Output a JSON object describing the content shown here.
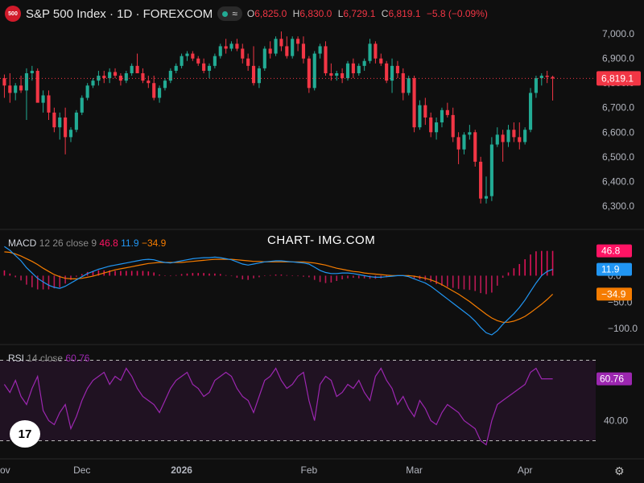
{
  "header": {
    "logo_text": "500",
    "title": "S&P 500 Index · 1D · FOREXCOM",
    "pill_symbol": "≈",
    "open_label": "O",
    "open": "6,825.0",
    "high_label": "H",
    "high": "6,830.0",
    "low_label": "L",
    "low": "6,729.1",
    "close_label": "C",
    "close": "6,819.1",
    "change": "−5.8 (−0.09%)"
  },
  "watermark": "CHART- IMG.COM",
  "tv_logo": "17",
  "colors": {
    "up": "#22ab94",
    "down": "#f23645",
    "macd": "#2196f3",
    "signal": "#f57c00",
    "rsi": "#9c27b0",
    "background": "#0f0f0f"
  },
  "chart_data": [
    {
      "type": "candlestick",
      "title": "S&P 500 Index · 1D · FOREXCOM",
      "y_ticks": [
        6300,
        6400,
        6500,
        6600,
        6700,
        6800,
        6900,
        7000
      ],
      "y_tick_labels": [
        "6,300.0",
        "6,400.0",
        "6,500.0",
        "6,600.0",
        "6,700.0",
        "6,800.0",
        "6,900.0",
        "7,000.0"
      ],
      "ylim": [
        6270,
        7030
      ],
      "x_labels": [
        "ov",
        "Dec",
        "2026",
        "Feb",
        "Mar",
        "Apr"
      ],
      "last_price_label": "6,819.1",
      "last_price": 6819.1,
      "candles": [
        [
          6820,
          6835,
          6740,
          6790
        ],
        [
          6790,
          6840,
          6720,
          6760
        ],
        [
          6760,
          6800,
          6730,
          6790
        ],
        [
          6790,
          6830,
          6760,
          6770
        ],
        [
          6770,
          6860,
          6650,
          6840
        ],
        [
          6840,
          6870,
          6810,
          6850
        ],
        [
          6850,
          6860,
          6750,
          6720
        ],
        [
          6720,
          6770,
          6680,
          6750
        ],
        [
          6750,
          6770,
          6650,
          6680
        ],
        [
          6680,
          6700,
          6600,
          6620
        ],
        [
          6620,
          6680,
          6570,
          6660
        ],
        [
          6660,
          6700,
          6510,
          6580
        ],
        [
          6580,
          6620,
          6560,
          6610
        ],
        [
          6610,
          6690,
          6600,
          6680
        ],
        [
          6680,
          6750,
          6670,
          6740
        ],
        [
          6740,
          6800,
          6730,
          6790
        ],
        [
          6790,
          6820,
          6780,
          6810
        ],
        [
          6810,
          6850,
          6790,
          6830
        ],
        [
          6830,
          6850,
          6800,
          6820
        ],
        [
          6820,
          6860,
          6800,
          6845
        ],
        [
          6845,
          6860,
          6820,
          6830
        ],
        [
          6830,
          6840,
          6790,
          6810
        ],
        [
          6810,
          6850,
          6800,
          6840
        ],
        [
          6840,
          6880,
          6830,
          6870
        ],
        [
          6870,
          6920,
          6850,
          6840
        ],
        [
          6840,
          6860,
          6800,
          6810
        ],
        [
          6810,
          6830,
          6780,
          6800
        ],
        [
          6800,
          6830,
          6730,
          6740
        ],
        [
          6740,
          6790,
          6720,
          6780
        ],
        [
          6780,
          6820,
          6770,
          6810
        ],
        [
          6810,
          6860,
          6800,
          6850
        ],
        [
          6850,
          6880,
          6840,
          6870
        ],
        [
          6870,
          6920,
          6860,
          6910
        ],
        [
          6910,
          6930,
          6890,
          6920
        ],
        [
          6920,
          6930,
          6890,
          6900
        ],
        [
          6900,
          6910,
          6870,
          6880
        ],
        [
          6880,
          6900,
          6840,
          6850
        ],
        [
          6850,
          6880,
          6820,
          6870
        ],
        [
          6870,
          6920,
          6860,
          6910
        ],
        [
          6910,
          6960,
          6900,
          6950
        ],
        [
          6950,
          6980,
          6920,
          6940
        ],
        [
          6940,
          6970,
          6930,
          6960
        ],
        [
          6960,
          6980,
          6930,
          6940
        ],
        [
          6940,
          6960,
          6880,
          6900
        ],
        [
          6900,
          6920,
          6850,
          6870
        ],
        [
          6870,
          6950,
          6790,
          6800
        ],
        [
          6800,
          6870,
          6780,
          6860
        ],
        [
          6860,
          6950,
          6850,
          6940
        ],
        [
          6940,
          6970,
          6900,
          6920
        ],
        [
          6920,
          6990,
          6910,
          6980
        ],
        [
          6980,
          7010,
          6930,
          6950
        ],
        [
          6950,
          6990,
          6900,
          6910
        ],
        [
          6910,
          6990,
          6900,
          6980
        ],
        [
          6980,
          6990,
          6930,
          6960
        ],
        [
          6960,
          6990,
          6880,
          6900
        ],
        [
          6900,
          6910,
          6760,
          6780
        ],
        [
          6780,
          6930,
          6770,
          6920
        ],
        [
          6920,
          6960,
          6900,
          6950
        ],
        [
          6950,
          6970,
          6830,
          6840
        ],
        [
          6840,
          6880,
          6810,
          6830
        ],
        [
          6830,
          6850,
          6810,
          6840
        ],
        [
          6840,
          6860,
          6800,
          6820
        ],
        [
          6820,
          6890,
          6810,
          6880
        ],
        [
          6880,
          6900,
          6820,
          6840
        ],
        [
          6840,
          6880,
          6830,
          6870
        ],
        [
          6870,
          6900,
          6850,
          6890
        ],
        [
          6890,
          6980,
          6880,
          6960
        ],
        [
          6960,
          6970,
          6880,
          6900
        ],
        [
          6900,
          6920,
          6870,
          6880
        ],
        [
          6880,
          6890,
          6800,
          6810
        ],
        [
          6810,
          6900,
          6760,
          6870
        ],
        [
          6870,
          6890,
          6820,
          6840
        ],
        [
          6840,
          6860,
          6730,
          6760
        ],
        [
          6760,
          6830,
          6750,
          6820
        ],
        [
          6820,
          6830,
          6600,
          6620
        ],
        [
          6620,
          6730,
          6610,
          6710
        ],
        [
          6710,
          6740,
          6630,
          6660
        ],
        [
          6660,
          6680,
          6580,
          6600
        ],
        [
          6600,
          6660,
          6570,
          6640
        ],
        [
          6640,
          6700,
          6620,
          6690
        ],
        [
          6690,
          6720,
          6660,
          6670
        ],
        [
          6670,
          6700,
          6560,
          6580
        ],
        [
          6580,
          6600,
          6470,
          6530
        ],
        [
          6530,
          6600,
          6510,
          6590
        ],
        [
          6590,
          6630,
          6570,
          6600
        ],
        [
          6600,
          6610,
          6460,
          6480
        ],
        [
          6480,
          6500,
          6310,
          6330
        ],
        [
          6330,
          6420,
          6310,
          6340
        ],
        [
          6340,
          6580,
          6320,
          6550
        ],
        [
          6550,
          6620,
          6540,
          6590
        ],
        [
          6590,
          6610,
          6480,
          6560
        ],
        [
          6560,
          6630,
          6540,
          6610
        ],
        [
          6610,
          6640,
          6560,
          6580
        ],
        [
          6580,
          6640,
          6530,
          6560
        ],
        [
          6560,
          6620,
          6550,
          6610
        ],
        [
          6610,
          6780,
          6600,
          6760
        ],
        [
          6760,
          6830,
          6740,
          6820
        ],
        [
          6820,
          6840,
          6790,
          6830
        ],
        [
          6830,
          6850,
          6800,
          6825
        ],
        [
          6825,
          6830,
          6729,
          6819
        ]
      ]
    },
    {
      "type": "line",
      "title": "MACD",
      "params": "12 26 close 9",
      "legend_values": [
        "46.8",
        "11.9",
        "−34.9"
      ],
      "y_tick_labels": [
        "0.0",
        "−50.0",
        "−100.0"
      ],
      "y_ticks": [
        0,
        -50,
        -100
      ],
      "ylim": [
        -115,
        60
      ],
      "badges": [
        {
          "text": "46.8",
          "value": 46.8,
          "color": "#ff1464"
        },
        {
          "text": "11.9",
          "value": 11.9,
          "color": "#2196f3"
        },
        {
          "text": "−34.9",
          "value": -34.9,
          "color": "#f57c00"
        }
      ],
      "series": [
        {
          "values": [
            55,
            48,
            38,
            28,
            15,
            5,
            -5,
            -12,
            -18,
            -22,
            -24,
            -20,
            -14,
            -8,
            -2,
            4,
            8,
            12,
            15,
            18,
            20,
            22,
            24,
            26,
            28,
            30,
            31,
            30,
            27,
            25,
            24,
            26,
            28,
            30,
            32,
            33,
            34,
            34,
            35,
            34,
            32,
            30,
            26,
            22,
            20,
            22,
            24,
            26,
            27,
            28,
            28,
            27,
            26,
            25,
            24,
            22,
            16,
            10,
            6,
            4,
            4,
            5,
            5,
            4,
            2,
            0,
            -2,
            -3,
            -3,
            -2,
            -1,
            0,
            0,
            -2,
            -6,
            -10,
            -14,
            -20,
            -28,
            -36,
            -44,
            -52,
            -60,
            -68,
            -76,
            -86,
            -98,
            -108,
            -112,
            -104,
            -92,
            -82,
            -72,
            -60,
            -46,
            -30,
            -14,
            0,
            8,
            11.9
          ]
        },
        {
          "values": [
            45,
            44,
            41,
            37,
            32,
            27,
            21,
            14,
            8,
            2,
            -2,
            -5,
            -6,
            -6,
            -5,
            -3,
            -1,
            2,
            5,
            8,
            11,
            13,
            15,
            17,
            19,
            21,
            23,
            24,
            25,
            25,
            25,
            25,
            25,
            26,
            27,
            28,
            29,
            30,
            31,
            31,
            31,
            31,
            30,
            29,
            28,
            27,
            27,
            26,
            26,
            26,
            26,
            26,
            26,
            26,
            26,
            25,
            24,
            22,
            20,
            17,
            14,
            12,
            10,
            8,
            7,
            5,
            4,
            3,
            2,
            1,
            0,
            0,
            0,
            0,
            -1,
            -3,
            -5,
            -8,
            -12,
            -17,
            -23,
            -29,
            -35,
            -42,
            -49,
            -57,
            -65,
            -73,
            -80,
            -85,
            -88,
            -88,
            -86,
            -82,
            -77,
            -70,
            -62,
            -54,
            -45,
            -34.9
          ]
        },
        {
          "histogram": [
            10,
            4,
            -3,
            -9,
            -17,
            -22,
            -26,
            -26,
            -26,
            -24,
            -22,
            -15,
            -8,
            -2,
            3,
            7,
            9,
            10,
            10,
            10,
            9,
            9,
            9,
            9,
            9,
            9,
            8,
            6,
            2,
            0,
            -1,
            1,
            3,
            4,
            5,
            5,
            5,
            4,
            4,
            3,
            1,
            -1,
            -4,
            -7,
            -8,
            -5,
            -3,
            0,
            1,
            2,
            2,
            1,
            0,
            -1,
            -2,
            -3,
            -8,
            -12,
            -14,
            -13,
            -10,
            -7,
            -5,
            -4,
            -5,
            -5,
            -6,
            -6,
            -5,
            -3,
            -1,
            0,
            0,
            -2,
            -5,
            -7,
            -9,
            -12,
            -16,
            -19,
            -21,
            -23,
            -25,
            -26,
            -27,
            -29,
            -33,
            -35,
            -32,
            -19,
            -4,
            6,
            14,
            22,
            31,
            40,
            46,
            46.8,
            46.8,
            46.8
          ]
        }
      ]
    },
    {
      "type": "line",
      "title": "RSI",
      "params": "14 close",
      "legend_values": [
        "60.76"
      ],
      "y_tick_labels": [
        "40.00"
      ],
      "y_ticks": [
        40
      ],
      "ylim": [
        25,
        75
      ],
      "band": [
        30,
        70
      ],
      "last_label": "60.76",
      "series": [
        {
          "values": [
            58,
            54,
            60,
            52,
            48,
            56,
            62,
            45,
            40,
            38,
            44,
            48,
            36,
            42,
            50,
            56,
            60,
            62,
            64,
            58,
            62,
            60,
            66,
            62,
            56,
            52,
            50,
            48,
            44,
            50,
            56,
            60,
            62,
            64,
            58,
            56,
            52,
            54,
            60,
            62,
            64,
            62,
            56,
            52,
            50,
            44,
            52,
            60,
            62,
            66,
            60,
            56,
            58,
            62,
            64,
            50,
            40,
            58,
            62,
            60,
            52,
            54,
            58,
            56,
            60,
            54,
            50,
            62,
            66,
            60,
            56,
            48,
            52,
            46,
            42,
            50,
            46,
            40,
            38,
            44,
            48,
            46,
            44,
            40,
            38,
            36,
            30,
            28,
            40,
            48,
            50,
            52,
            54,
            56,
            58,
            64,
            66,
            60.76,
            60.76,
            60.76
          ]
        }
      ]
    }
  ]
}
